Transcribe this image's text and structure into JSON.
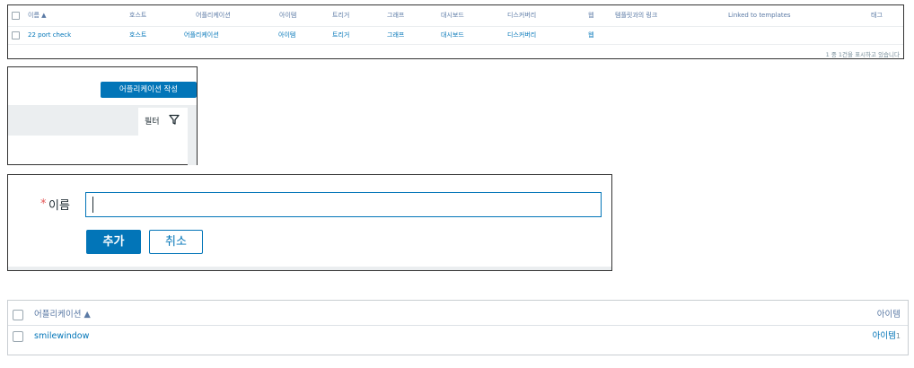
{
  "templates_table": {
    "headers": [
      "이름 ▲",
      "호스트",
      "어플리케이션",
      "아이템",
      "트리거",
      "그래프",
      "대시보드",
      "디스커버리",
      "웹",
      "템플릿과의 링크",
      "Linked to templates",
      "태그"
    ],
    "row": {
      "name": "22 port check",
      "hosts": "호스트",
      "applications": "어플리케이션",
      "items": "아이템",
      "triggers": "트리거",
      "graphs": "그래프",
      "dashboards": "대시보드",
      "discovery": "디스커버리",
      "web": "웹"
    },
    "footer": "1 중 1건을 표시하고 있습니다"
  },
  "create_panel": {
    "create_button": "어플리케이션 작성",
    "filter_label": "필터",
    "filter_icon": "filter-icon"
  },
  "name_form": {
    "required_mark": "*",
    "name_label": "이름",
    "name_value": "",
    "add_button": "추가",
    "cancel_button": "취소"
  },
  "app_list": {
    "header_name": "어플리케이션 ▲",
    "header_items": "아이템",
    "row": {
      "name": "smilewindow",
      "items_label": "아이템",
      "items_count": "1"
    }
  },
  "colors": {
    "accent": "#0275b8",
    "header_text": "#5b7aa5",
    "required": "#e45959",
    "panel_bg": "#ebeef0"
  }
}
